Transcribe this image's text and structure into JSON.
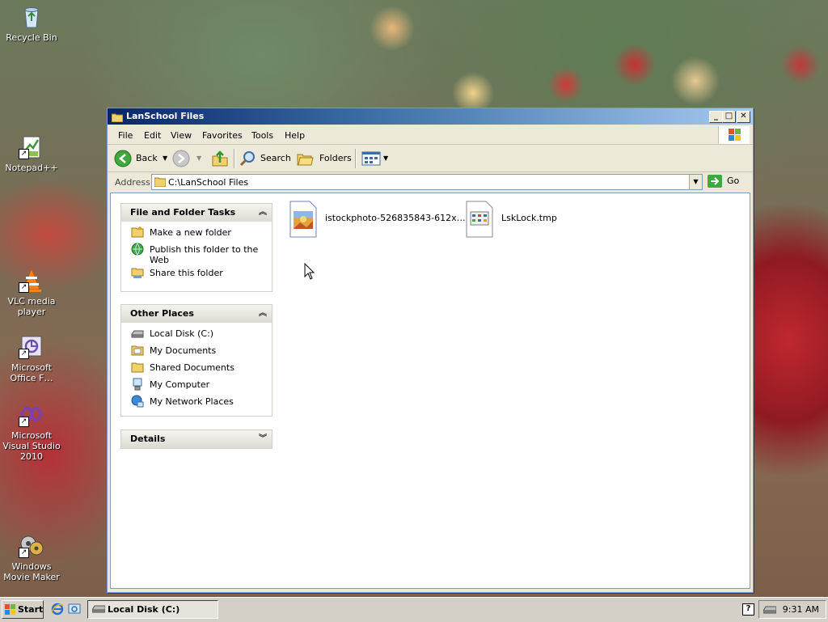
{
  "desktop": {
    "icons": [
      {
        "label": "Recycle Bin",
        "icon": "recycle-bin-icon"
      },
      {
        "label": "Notepad++",
        "icon": "notepad-plus-plus-icon"
      },
      {
        "label": "VLC media player",
        "icon": "vlc-icon"
      },
      {
        "label": "Microsoft Office F…",
        "icon": "office-icon"
      },
      {
        "label": "Microsoft Visual Studio 2010",
        "icon": "visual-studio-icon"
      },
      {
        "label": "Windows Movie Maker",
        "icon": "movie-maker-icon"
      }
    ]
  },
  "window": {
    "title": "LanSchool Files",
    "controls": {
      "minimize": "_",
      "maximize": "□",
      "close": "✕"
    },
    "menu": [
      "File",
      "Edit",
      "View",
      "Favorites",
      "Tools",
      "Help"
    ],
    "toolbar": {
      "back": "Back",
      "search": "Search",
      "folders": "Folders"
    },
    "address": {
      "label": "Address",
      "value": "C:\\LanSchool Files",
      "go": "Go"
    },
    "tasks": {
      "file_folder": {
        "title": "File and Folder Tasks",
        "items": [
          "Make a new folder",
          "Publish this folder to the Web",
          "Share this folder"
        ]
      },
      "other_places": {
        "title": "Other Places",
        "items": [
          "Local Disk (C:)",
          "My Documents",
          "Shared Documents",
          "My Computer",
          "My Network Places"
        ]
      },
      "details": {
        "title": "Details"
      }
    },
    "files": [
      {
        "name": "istockphoto-526835843-612x…",
        "icon": "image-file-icon"
      },
      {
        "name": "LskLock.tmp",
        "icon": "tmp-file-icon"
      }
    ]
  },
  "taskbar": {
    "start": "Start",
    "task": "Local Disk (C:)",
    "help": "?",
    "clock": "9:31 AM"
  },
  "colors": {
    "titlebar_start": "#0a246a",
    "titlebar_end": "#a6caf0",
    "window_bg": "#ece9d8",
    "taskbar": "#d4d0c8"
  }
}
